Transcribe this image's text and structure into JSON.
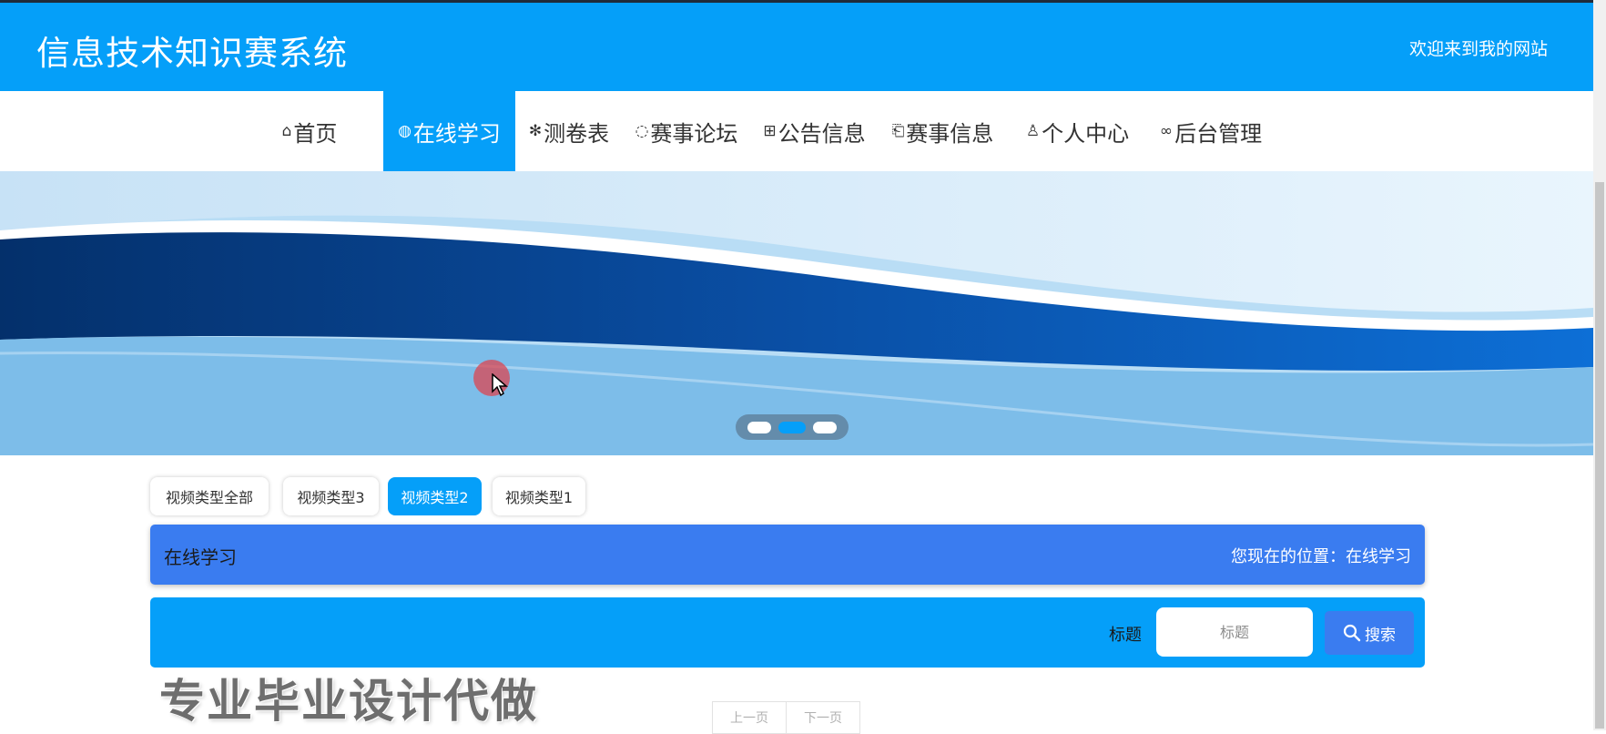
{
  "header": {
    "title": "信息技术知识赛系统",
    "welcome": "欢迎来到我的网站"
  },
  "nav": {
    "items": [
      {
        "label": "首页",
        "icon": "home-icon",
        "glyph": "⌂"
      },
      {
        "label": "在线学习",
        "icon": "globe-icon",
        "glyph": "◍"
      },
      {
        "label": "测卷表",
        "icon": "snowflake-icon",
        "glyph": "✻"
      },
      {
        "label": "赛事论坛",
        "icon": "chat-bubble-icon",
        "glyph": "◌"
      },
      {
        "label": "公告信息",
        "icon": "grid-icon",
        "glyph": "⊞"
      },
      {
        "label": "赛事信息",
        "icon": "book-icon",
        "glyph": "⎗"
      },
      {
        "label": "个人中心",
        "icon": "user-icon",
        "glyph": "♙"
      },
      {
        "label": "后台管理",
        "icon": "link-icon",
        "glyph": "∞"
      }
    ],
    "active_index": 1
  },
  "banner": {
    "slide_count": 3,
    "active_slide": 1
  },
  "filters": {
    "items": [
      "视频类型全部",
      "视频类型3",
      "视频类型2",
      "视频类型1"
    ],
    "active_index": 2
  },
  "section": {
    "title": "在线学习",
    "location": "您现在的位置：在线学习"
  },
  "search": {
    "label": "标题",
    "placeholder": "标题",
    "button_label": "搜索"
  },
  "watermark": "专业毕业设计代做",
  "pagination": {
    "prev_label": "上一页",
    "next_label": "下一页"
  },
  "colors": {
    "primary": "#059ff9",
    "accent": "#3a7cf0"
  }
}
